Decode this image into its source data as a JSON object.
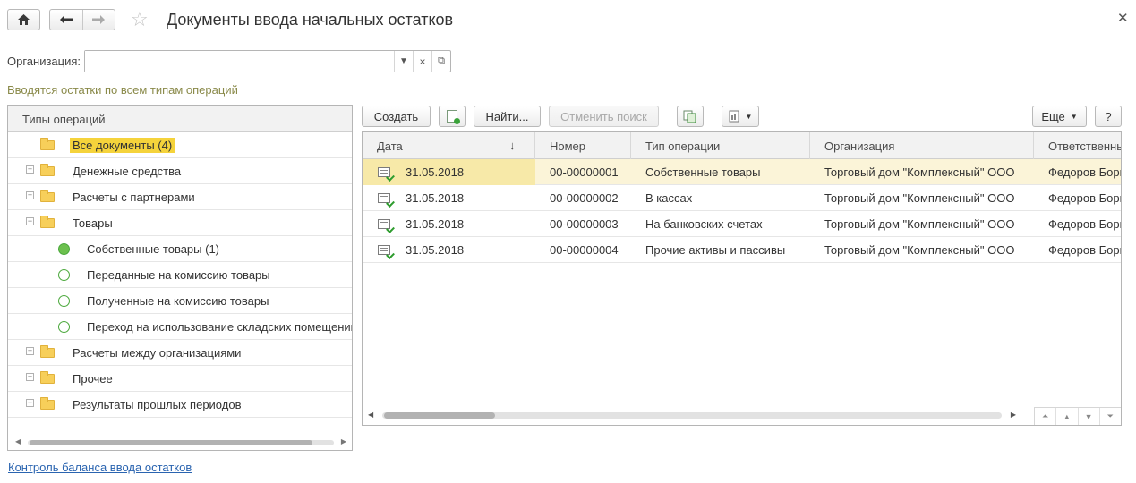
{
  "header": {
    "title": "Документы ввода начальных остатков",
    "home_icon": "home-icon",
    "back_icon": "arrow-left-icon",
    "forward_icon": "arrow-right-icon",
    "favorite_icon": "star-icon",
    "close_icon": "close-icon"
  },
  "filter": {
    "org_label": "Организация:",
    "org_value": "",
    "hint": "Вводятся остатки по всем типам операций"
  },
  "tree": {
    "header": "Типы операций",
    "items": [
      {
        "label": "Все документы (4)",
        "type": "folder",
        "expander": "",
        "selected": true
      },
      {
        "label": "Денежные средства",
        "type": "folder",
        "expander": "+"
      },
      {
        "label": "Расчеты с партнерами",
        "type": "folder",
        "expander": "+"
      },
      {
        "label": "Товары",
        "type": "folder",
        "expander": "−"
      },
      {
        "label": "Собственные товары (1)",
        "type": "leaf",
        "filled": true
      },
      {
        "label": "Переданные на комиссию товары",
        "type": "leaf"
      },
      {
        "label": "Полученные на комиссию товары",
        "type": "leaf"
      },
      {
        "label": "Переход на использование складских помещений",
        "type": "leaf"
      },
      {
        "label": "Расчеты между организациями",
        "type": "folder",
        "expander": "+"
      },
      {
        "label": "Прочее",
        "type": "folder",
        "expander": "+"
      },
      {
        "label": "Результаты прошлых периодов",
        "type": "folder",
        "expander": "+"
      }
    ]
  },
  "toolbar": {
    "create": "Создать",
    "find": "Найти...",
    "cancel_search": "Отменить поиск",
    "more": "Еще",
    "help": "?"
  },
  "grid": {
    "columns": [
      "Дата",
      "Номер",
      "Тип операции",
      "Организация",
      "Ответственный"
    ],
    "sort_indicator": "↓",
    "rows": [
      {
        "date": "31.05.2018",
        "number": "00-00000001",
        "op_type": "Собственные товары",
        "org": "Торговый дом \"Комплексный\" ООО",
        "resp": "Федоров Борис",
        "selected": true
      },
      {
        "date": "31.05.2018",
        "number": "00-00000002",
        "op_type": "В кассах",
        "org": "Торговый дом \"Комплексный\" ООО",
        "resp": "Федоров Борис"
      },
      {
        "date": "31.05.2018",
        "number": "00-00000003",
        "op_type": "На банковских счетах",
        "org": "Торговый дом \"Комплексный\" ООО",
        "resp": "Федоров Борис"
      },
      {
        "date": "31.05.2018",
        "number": "00-00000004",
        "op_type": "Прочие активы и пассивы",
        "org": "Торговый дом \"Комплексный\" ООО",
        "resp": "Федоров Борис"
      }
    ]
  },
  "footer": {
    "link": "Контроль баланса ввода остатков"
  }
}
